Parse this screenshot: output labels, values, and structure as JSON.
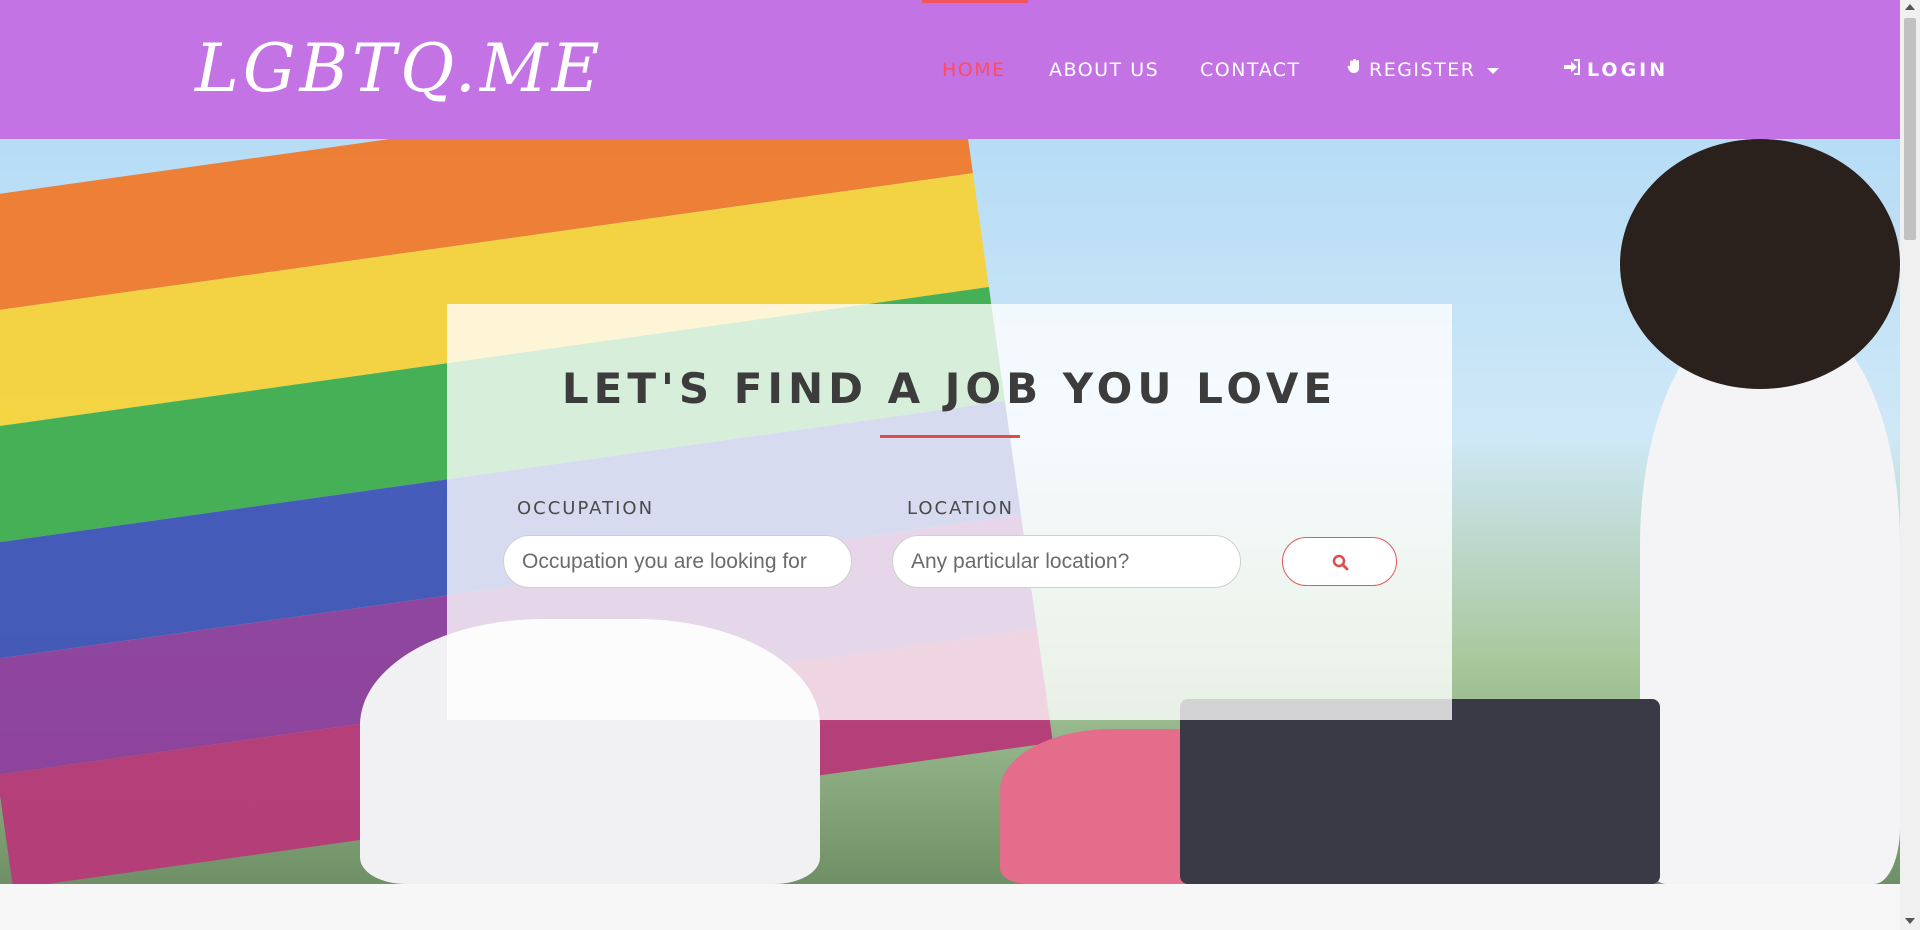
{
  "brand": {
    "name": "LGBTQ.ME"
  },
  "nav": {
    "home": "HOME",
    "about": "ABOUT US",
    "contact": "CONTACT",
    "register": "REGISTER",
    "login": "LOGIN"
  },
  "hero": {
    "title": "LET'S FIND A JOB YOU LOVE",
    "occupation_label": "OCCUPATION",
    "occupation_placeholder": "Occupation you are looking for",
    "location_label": "LOCATION",
    "location_placeholder": "Any particular location?"
  },
  "icons": {
    "register": "hand-icon",
    "login": "sign-in-icon",
    "search": "search-icon"
  },
  "colors": {
    "navbar": "#c473e4",
    "active_nav": "#ff4b5c",
    "accent": "#e24b4b"
  }
}
